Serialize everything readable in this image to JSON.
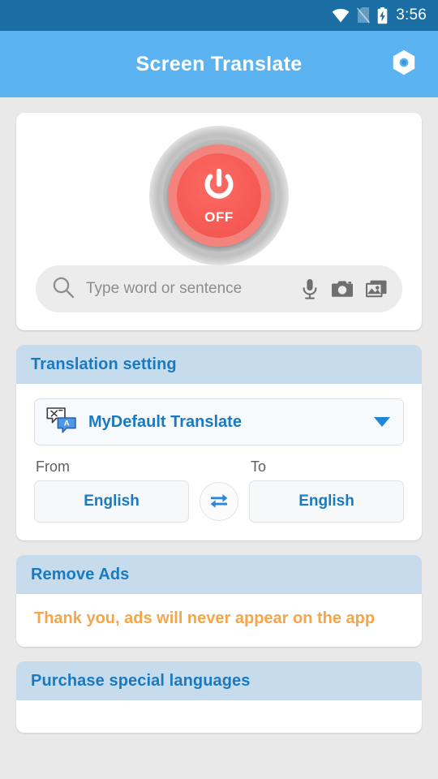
{
  "status_bar": {
    "time": "3:56",
    "icons": [
      "wifi-icon",
      "sim-card-off-icon",
      "battery-charging-icon"
    ]
  },
  "app_bar": {
    "title": "Screen Translate",
    "action_icon": "settings-gear-icon"
  },
  "power": {
    "state_label": "OFF",
    "icon": "power-icon",
    "color": "#f65b55"
  },
  "search": {
    "value": "",
    "placeholder": "Type word or sentence",
    "icons": {
      "search": "search-icon",
      "mic": "microphone-icon",
      "camera": "camera-icon",
      "gallery": "gallery-image-icon"
    }
  },
  "translation_setting": {
    "header": "Translation setting",
    "engine": {
      "name": "MyDefault Translate",
      "icon": "translate-bubbles-icon",
      "caret": "chevron-down-icon"
    },
    "from": {
      "label": "From",
      "value": "English"
    },
    "to": {
      "label": "To",
      "value": "English"
    },
    "swap_icon": "swap-arrows-icon"
  },
  "remove_ads": {
    "header": "Remove Ads",
    "message": "Thank you, ads will never appear on the app"
  },
  "purchase_languages": {
    "header": "Purchase special languages"
  },
  "colors": {
    "status_bar": "#1a6ea4",
    "app_bar": "#5cb3f2",
    "page_bg": "#e9e9e9",
    "section_header": "#c6dced",
    "accent_blue": "#1a7ac0",
    "ads_orange": "#f5a54a",
    "power_red": "#f65b55"
  }
}
